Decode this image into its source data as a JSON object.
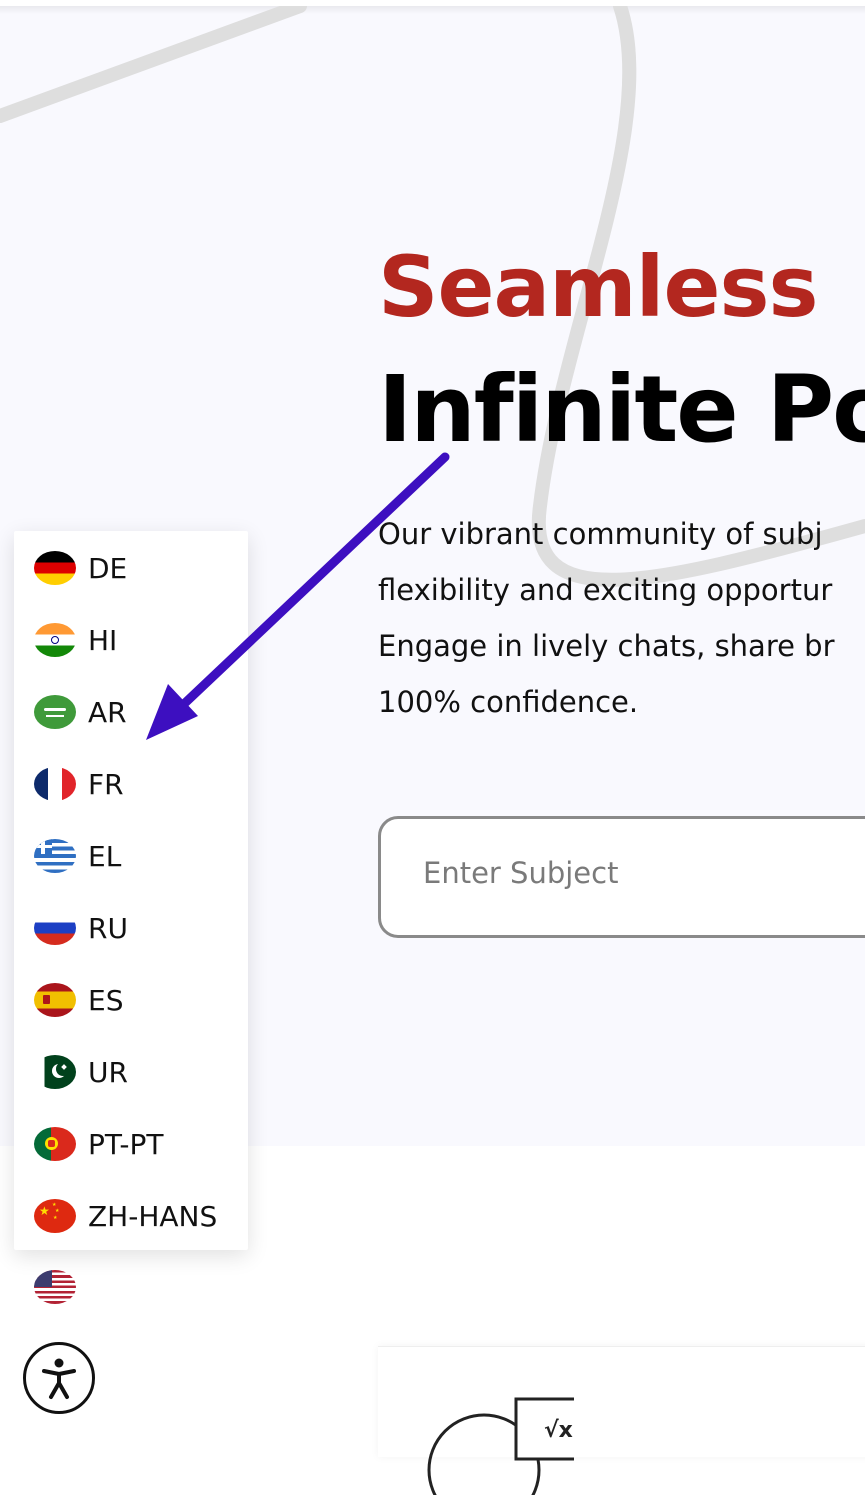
{
  "hero": {
    "headline_line1": "Seamless",
    "headline_line2": "Infinite Po",
    "description_lines": [
      "Our vibrant community of subj",
      "flexibility and exciting opportur",
      "Engage in lively chats, share br",
      "100% confidence."
    ],
    "subject_input": {
      "placeholder": "Enter Subject",
      "value": ""
    }
  },
  "language_menu": {
    "items": [
      {
        "code": "DE",
        "flag": "germany-flag-icon"
      },
      {
        "code": "HI",
        "flag": "india-flag-icon"
      },
      {
        "code": "AR",
        "flag": "saudi-arabia-flag-icon"
      },
      {
        "code": "FR",
        "flag": "france-flag-icon"
      },
      {
        "code": "EL",
        "flag": "greece-flag-icon"
      },
      {
        "code": "RU",
        "flag": "russia-flag-icon"
      },
      {
        "code": "ES",
        "flag": "spain-flag-icon"
      },
      {
        "code": "UR",
        "flag": "pakistan-flag-icon"
      },
      {
        "code": "PT-PT",
        "flag": "portugal-flag-icon"
      },
      {
        "code": "ZH-HANS",
        "flag": "china-flag-icon"
      }
    ],
    "current_flag": "usa-flag-icon"
  },
  "accessibility": {
    "icon": "accessibility-icon"
  },
  "colors": {
    "accent_red": "#b3271f",
    "arrow_purple": "#3d0fc0",
    "hero_bg": "#f9f9fe"
  }
}
